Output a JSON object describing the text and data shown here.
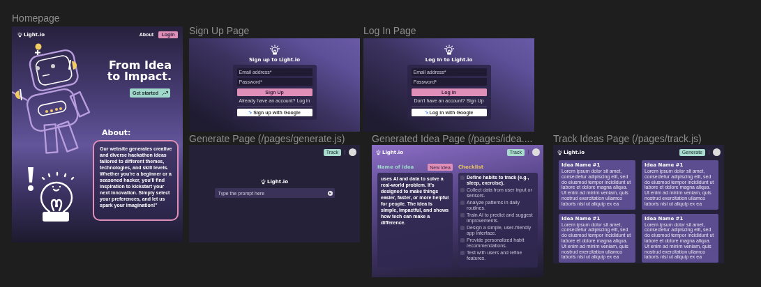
{
  "homepage": {
    "label": "Homepage",
    "logo": "Light.io",
    "nav": [
      {
        "label": "About",
        "kind": "link"
      },
      {
        "label": "Login",
        "kind": "button"
      }
    ],
    "headline": "From Idea to Impact.",
    "cta": "Get started",
    "about_title": "About:",
    "about_text": "Our website generates creative and diverse hackathon ideas tailored to different themes, technologies, and skill levels. Whether you're a beginner or a seasoned hacker, you'll find inspiration to kickstart your next innovation. Simply select your preferences, and let us spark your imagination!\""
  },
  "signup_page": {
    "label": "Sign Up Page",
    "title": "Sign up to Light.io",
    "fields": [
      {
        "placeholder": "Email address*"
      },
      {
        "placeholder": "Password*"
      }
    ],
    "submit": "Sign Up",
    "switch_text": "Already have an account? Log in",
    "google_button": "Sign up with Google"
  },
  "login_page": {
    "label": "Log In Page",
    "title": "Log In to Light.io",
    "fields": [
      {
        "placeholder": "Email address*"
      },
      {
        "placeholder": "Password*"
      }
    ],
    "submit": "Log in",
    "switch_text": "Don't have an account? Sign Up",
    "google_button": "Log in with Google"
  },
  "generate_page": {
    "label": "Generate Page (/pages/generate.js)",
    "nav_button": "Track",
    "logo": "Light.io",
    "prompt": {
      "placeholder": "Type the prompt here"
    }
  },
  "idea_page": {
    "label": "Generated Idea Page (/pages/idea....",
    "logo": "Light.io",
    "nav_button": "Track",
    "idea_title": "Name of idea",
    "new_idea": "New Idea",
    "description": "uses AI and data to solve a real-world problem. It's designed to make things easier, faster, or more helpful for people. The idea is simple, impactful, and shows how tech can make a difference.",
    "checklist_title": "Checklist",
    "checklist": [
      {
        "text": "Define habits to track (e.g., sleep, exercise).",
        "checked": false,
        "selected": true
      },
      {
        "text": "Collect data from user input or sensors.",
        "checked": false,
        "selected": false
      },
      {
        "text": "Analyze patterns in daily routines.",
        "checked": false,
        "selected": false
      },
      {
        "text": "Train AI to predict and suggest improvements.",
        "checked": false,
        "selected": false
      },
      {
        "text": "Design a simple, user-friendly app interface.",
        "checked": false,
        "selected": false
      },
      {
        "text": "Provide personalized habit recommendations.",
        "checked": false,
        "selected": false
      },
      {
        "text": "Test with users and refine features.",
        "checked": false,
        "selected": false
      }
    ]
  },
  "track_page": {
    "label": "Track Ideas Page (/pages/track.js)",
    "logo": "Light.io",
    "nav_button": "Generate",
    "ideas": [
      {
        "title": "Idea Name #1",
        "body": "Lorem ipsum dolor sit amet, consectetur adipiscing elit, sed do eiusmod tempor incididunt ut labore et dolore magna aliqua. Ut enim ad minim veniam, quis nostrud exercitation ullamco laboris nisi ut aliquip ex ea"
      },
      {
        "title": "Idea Name #1",
        "body": "Lorem ipsum dolor sit amet, consectetur adipiscing elit, sed do eiusmod tempor incididunt ut labore et dolore magna aliqua. Ut enim ad minim veniam, quis nostrud exercitation ullamco laboris nisi ut aliquip ex ea"
      },
      {
        "title": "Idea Name #1",
        "body": "Lorem ipsum dolor sit amet, consectetur adipiscing elit, sed do eiusmod tempor incididunt ut labore et dolore magna aliqua. Ut enim ad minim veniam, quis nostrud exercitation ullamco laboris nisi ut aliquip ex ea"
      },
      {
        "title": "Idea Name #1",
        "body": "Lorem ipsum dolor sit amet, consectetur adipiscing elit, sed do eiusmod tempor incididunt ut labore et dolore magna aliqua. Ut enim ad minim veniam, quis nostrud exercitation ullamco laboris nisi ut aliquip ex ea"
      }
    ]
  }
}
